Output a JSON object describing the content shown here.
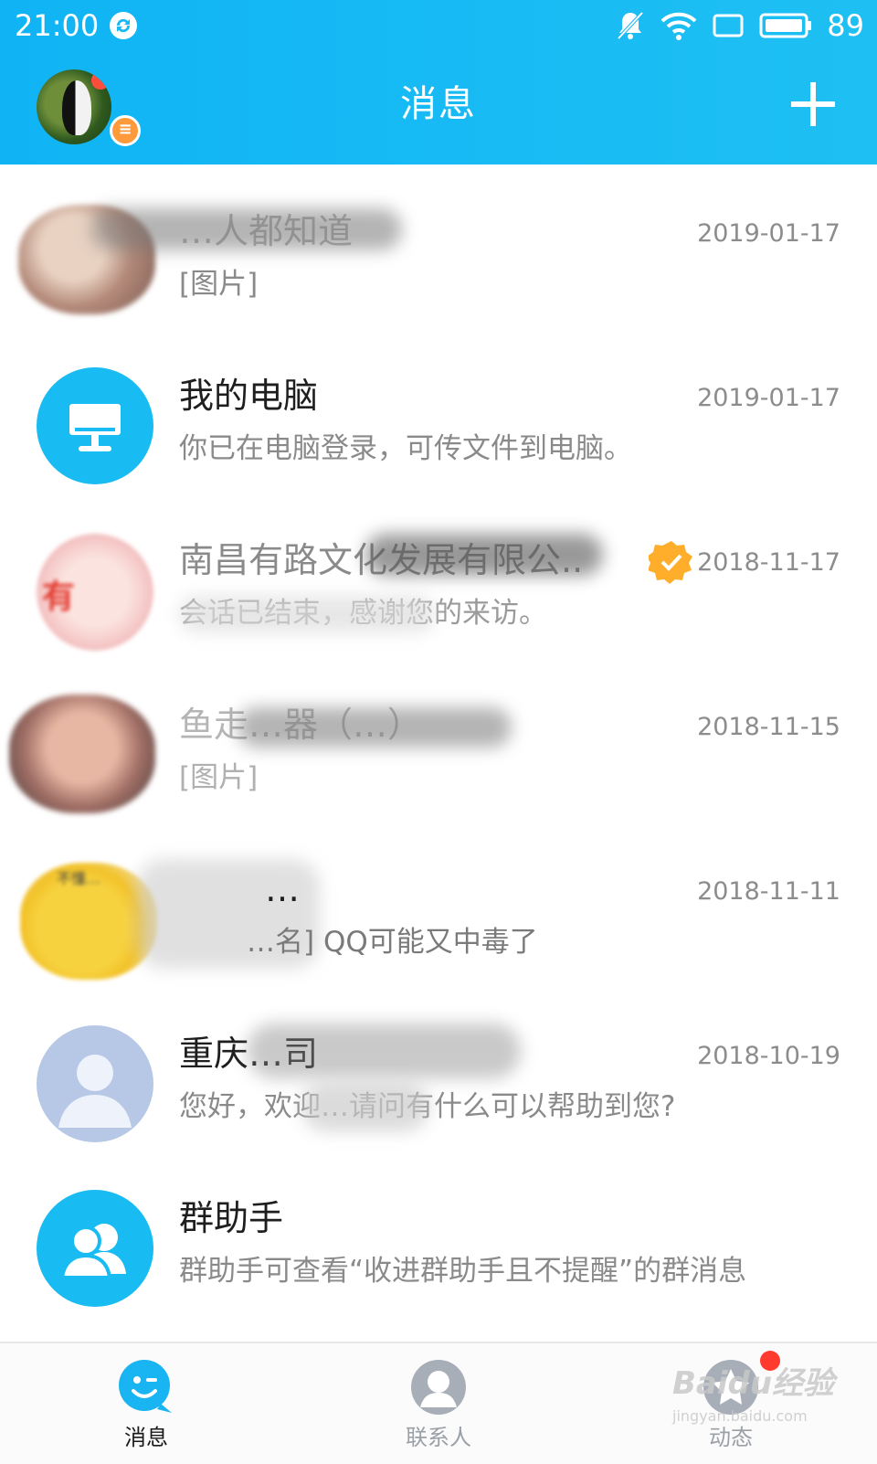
{
  "status_bar": {
    "time": "21:00",
    "battery": "89"
  },
  "header": {
    "title": "消息"
  },
  "conversations": [
    {
      "name": "…人都知道",
      "preview": "[图片]",
      "time": "2019-01-17"
    },
    {
      "name": "我的电脑",
      "preview": "你已在电脑登录，可传文件到电脑。",
      "time": "2019-01-17"
    },
    {
      "name": "南昌有路文化发展有限公..",
      "preview": "会话已结束，感谢您的来访。",
      "time": "2018-11-17",
      "avatar_text": "有"
    },
    {
      "name": "鱼走…器（…）",
      "preview": "[图片]",
      "time": "2018-11-15"
    },
    {
      "name": "…",
      "preview": "…名] QQ可能又中毒了",
      "time": "2018-11-11",
      "avatar_text": "不懂…"
    },
    {
      "name": "重庆…司",
      "preview": "您好，欢迎…请问有什么可以帮助到您?",
      "time": "2018-10-19"
    },
    {
      "name": "群助手",
      "preview": "群助手可查看“收进群助手且不提醒”的群消息",
      "time": ""
    }
  ],
  "tabs": [
    {
      "label": "消息",
      "active": true
    },
    {
      "label": "联系人",
      "active": false
    },
    {
      "label": "动态",
      "active": false
    }
  ],
  "watermark": {
    "brand": "Baidu经验",
    "url": "jingyan.baidu.com"
  },
  "colors": {
    "header": "#12b7f5",
    "badge_red": "#ff3b30",
    "verified": "#ffae2c"
  }
}
